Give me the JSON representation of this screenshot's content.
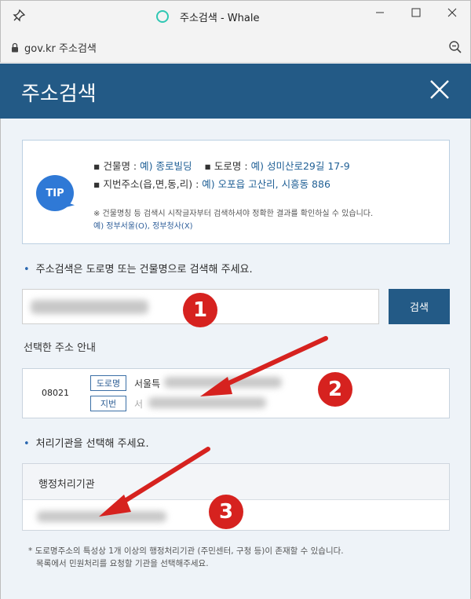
{
  "window": {
    "title": "주소검색 - Whale",
    "address": "gov.kr 주소검색"
  },
  "popup": {
    "title": "주소검색"
  },
  "tip": {
    "badge": "TIP",
    "line1_label_a": "건물명 : ",
    "line1_value_a": "예) 종로빌딩",
    "line1_label_b": "도로명 : ",
    "line1_value_b": "예) 성미산로29길 17-9",
    "line2_label": "지번주소(읍,면,동,리) : ",
    "line2_value": "예) 오포읍 고산리, 시흥동 886",
    "note": "※ 건물명칭 등 검색시 시작글자부터 검색하셔야 정확한 결과를 확인하실 수 있습니다.",
    "note_example": "예) 정부서울(O), 정부청사(X)"
  },
  "search": {
    "instruction": "주소검색은 도로명 또는 건물명으로 검색해 주세요.",
    "button_label": "검색"
  },
  "selected": {
    "heading": "선택한 주소 안내",
    "zipcode": "08021",
    "road_tag": "도로명",
    "road_prefix": "서울특",
    "jibun_tag": "지번",
    "jibun_prefix": "서"
  },
  "agency": {
    "instruction": "처리기관을 선택해 주세요.",
    "header": "행정처리기관"
  },
  "footnote": {
    "line1": "* 도로명주소의 특성상 1개 이상의 행정처리기관 (주민센터, 구청 등)이 존재할 수 있습니다.",
    "line2": "목록에서 민원처리를 요청할 기관을 선택해주세요."
  },
  "markers": [
    "1",
    "2",
    "3"
  ],
  "colors": {
    "header_bg": "#235a86",
    "content_bg": "#eef3f8",
    "tip_badge": "#2f79d6",
    "marker_red": "#d6221f",
    "whale_teal": "#2fc7b3"
  }
}
